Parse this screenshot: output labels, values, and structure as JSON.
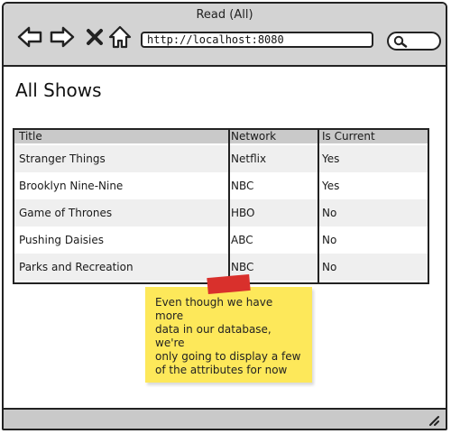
{
  "window": {
    "title": "Read (All)"
  },
  "toolbar": {
    "url": "http://localhost:8080",
    "icons": [
      "back-arrow-icon",
      "forward-arrow-icon",
      "close-icon",
      "home-icon",
      "search-icon"
    ]
  },
  "page": {
    "title": "All Shows"
  },
  "table": {
    "columns": [
      "Title",
      "Network",
      "Is Current"
    ],
    "rows": [
      {
        "title": "Stranger Things",
        "network": "Netflix",
        "is_current": "Yes"
      },
      {
        "title": "Brooklyn Nine-Nine",
        "network": "NBC",
        "is_current": "Yes"
      },
      {
        "title": "Game of Thrones",
        "network": "HBO",
        "is_current": "No"
      },
      {
        "title": "Pushing Daisies",
        "network": "ABC",
        "is_current": "No"
      },
      {
        "title": "Parks and Recreation",
        "network": "NBC",
        "is_current": "No"
      }
    ]
  },
  "note": {
    "lines": [
      "Even though we have more",
      "data in our database, we're",
      "only going to display a few",
      "of the attributes for now"
    ],
    "color": "#fde85a",
    "tape_color": "#d9302c"
  }
}
